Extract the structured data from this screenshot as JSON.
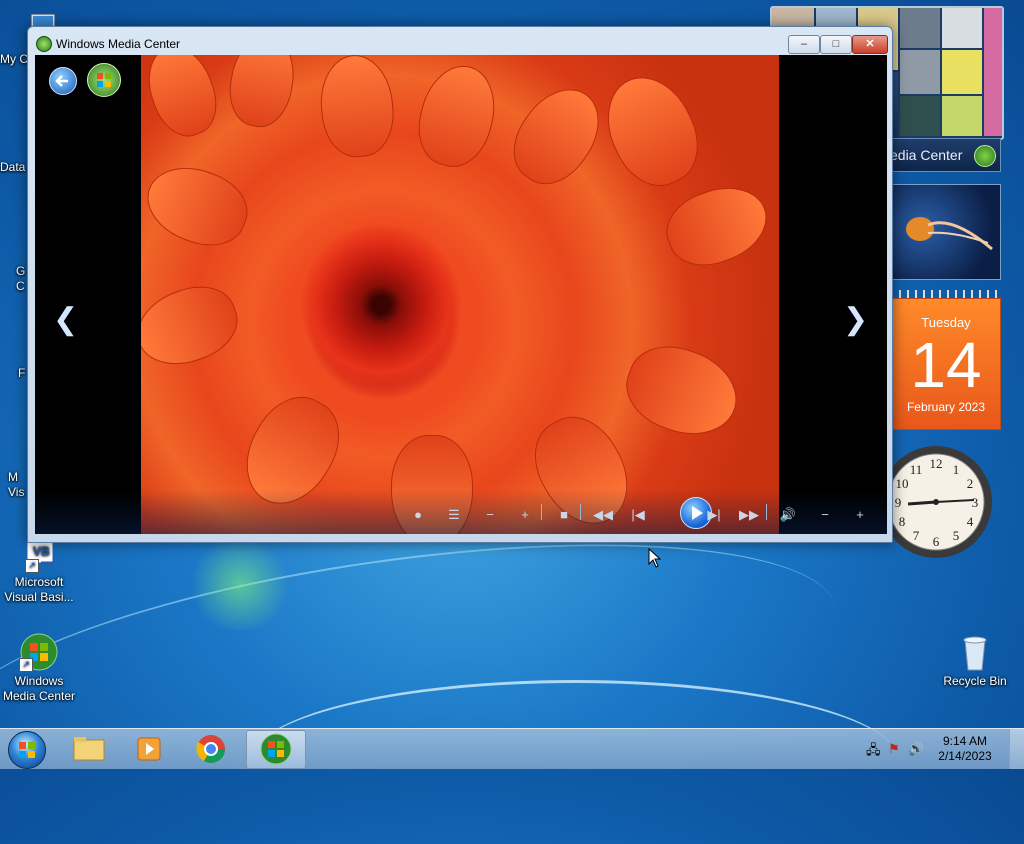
{
  "desktop": {
    "icons": [
      {
        "label": "My C"
      },
      {
        "label": "Data"
      },
      {
        "label": "G\nC"
      },
      {
        "label": "F"
      },
      {
        "label": "M\nVis"
      },
      {
        "label": "Microsoft Visual Basi..."
      },
      {
        "label": "Windows Media Center"
      },
      {
        "label": "Recycle Bin"
      }
    ]
  },
  "gadgets": {
    "media_center_label": "edia Center",
    "calendar": {
      "weekday": "Tuesday",
      "day": "14",
      "month_year": "February 2023"
    },
    "clock_numbers": [
      "12",
      "1",
      "2",
      "3",
      "4",
      "5",
      "6",
      "7",
      "8",
      "9",
      "10",
      "11"
    ]
  },
  "window": {
    "title": "Windows Media Center",
    "minimize": "–",
    "maximize": "□",
    "close": "✕"
  },
  "taskbar": {
    "time": "9:14 AM",
    "date": "2/14/2023"
  },
  "colors": {
    "accent": "#1766d8",
    "calendar_orange": "#e8571a"
  }
}
